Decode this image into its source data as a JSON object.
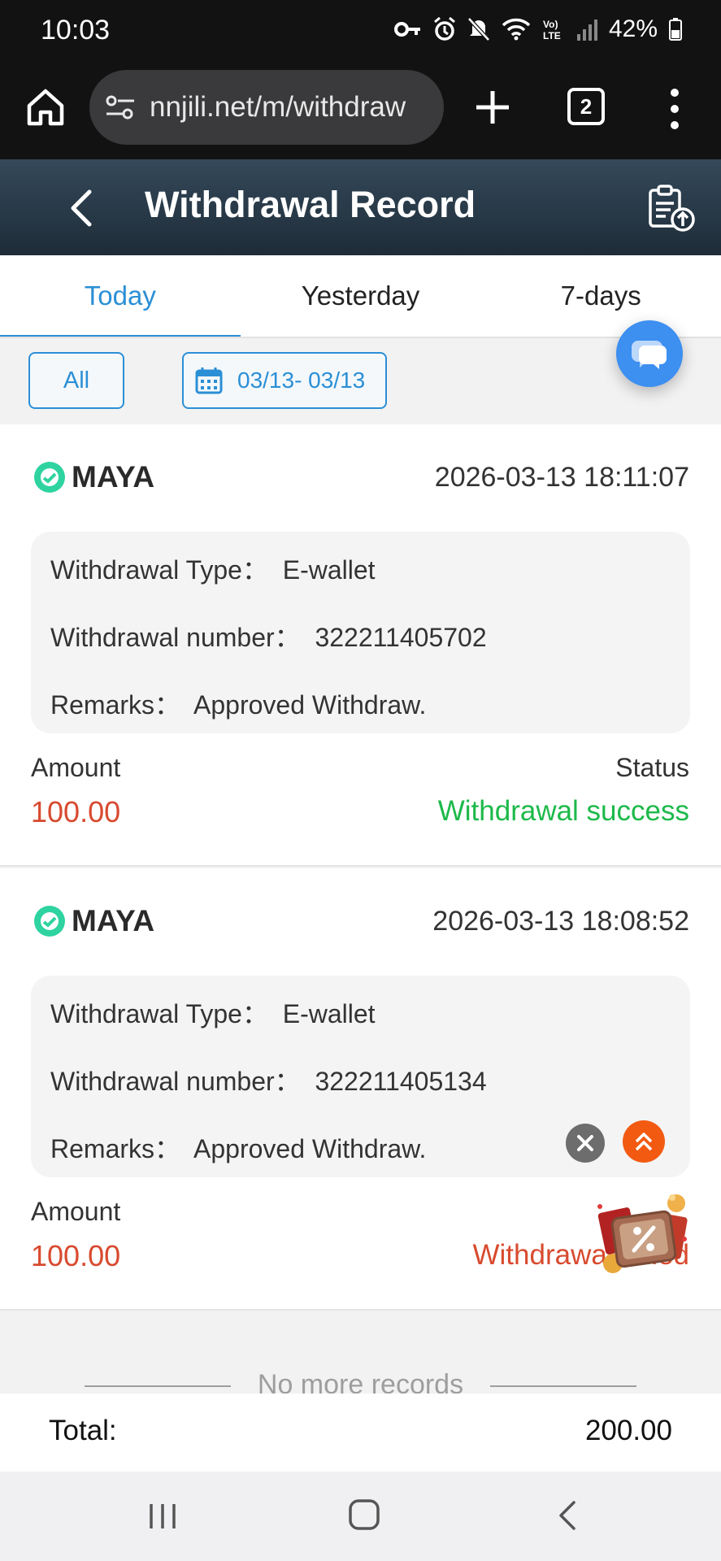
{
  "status_bar": {
    "time": "10:03",
    "battery": "42%",
    "icons": [
      "vpn-key-icon",
      "alarm-icon",
      "mute-icon",
      "wifi-icon",
      "volte-icon",
      "signal-icon",
      "battery-icon"
    ]
  },
  "browser": {
    "url": "nnjili.net/m/withdraw",
    "tab_count": "2"
  },
  "header": {
    "title": "Withdrawal Record"
  },
  "tabs": [
    {
      "label": "Today",
      "active": true
    },
    {
      "label": "Yesterday",
      "active": false
    },
    {
      "label": "7-days",
      "active": false
    }
  ],
  "filters": {
    "all_label": "All",
    "date_range": "03/13- 03/13"
  },
  "records": [
    {
      "method": "MAYA",
      "time": "2026-03-13 18:11:07",
      "type_line": "Withdrawal Type：  E-wallet",
      "number_line": "Withdrawal number：  322211405702",
      "remarks_line": "Remarks：  Approved Withdraw.",
      "amount_label": "Amount",
      "amount": "100.00",
      "status_label": "Status",
      "status": "Withdrawal success"
    },
    {
      "method": "MAYA",
      "time": "2026-03-13 18:08:52",
      "type_line": "Withdrawal Type：  E-wallet",
      "number_line": "Withdrawal number：  322211405134",
      "remarks_line": "Remarks：  Approved Withdraw.",
      "amount_label": "Amount",
      "amount": "100.00",
      "status": "Withdrawal failed"
    }
  ],
  "footer": {
    "no_more": "No more records",
    "total_label": "Total:",
    "total_value": "200.00"
  },
  "colors": {
    "accent": "#2b8fd6",
    "success": "#1db94a",
    "amount": "#d84a2f",
    "header_bg": "#263746"
  }
}
